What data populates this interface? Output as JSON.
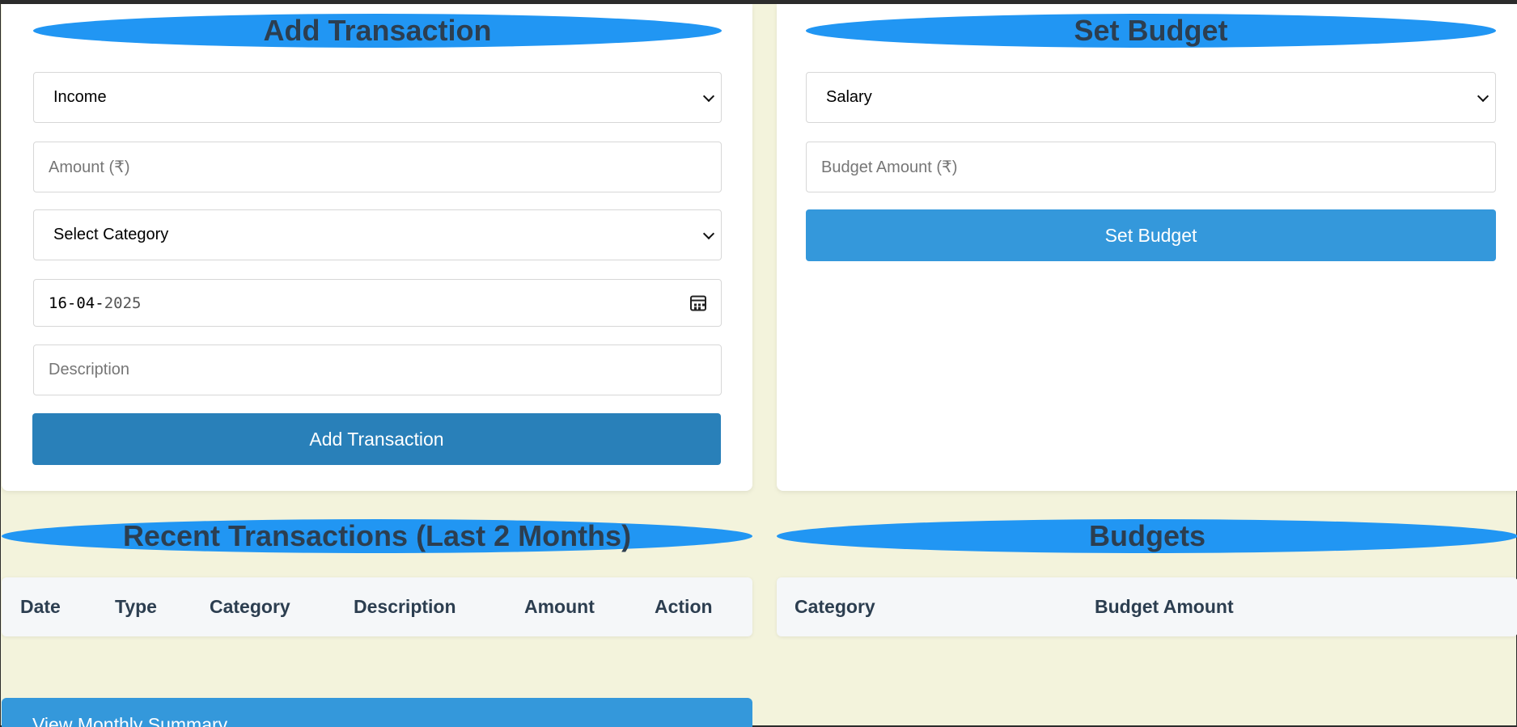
{
  "add_transaction": {
    "title": "Add Transaction",
    "type_value": "Income",
    "amount_placeholder": "Amount (₹)",
    "category_value": "Select Category",
    "date_day": "16",
    "date_month": "04",
    "date_year": "2025",
    "date_sep": "-",
    "description_placeholder": "Description",
    "submit_label": "Add Transaction"
  },
  "set_budget": {
    "title": "Set Budget",
    "category_value": "Salary",
    "amount_placeholder": "Budget Amount (₹)",
    "submit_label": "Set Budget"
  },
  "recent_transactions": {
    "title": "Recent Transactions (Last 2 Months)",
    "columns": [
      "Date",
      "Type",
      "Category",
      "Description",
      "Amount",
      "Action"
    ],
    "rows": []
  },
  "budgets": {
    "title": "Budgets",
    "columns": [
      "Category",
      "Budget Amount"
    ],
    "rows": []
  },
  "summary_button_label": "View Monthly Summary",
  "colors": {
    "background": "#f3f3dc",
    "heading_pill": "#2196f3",
    "heading_text": "#2c3e50",
    "primary_button": "#3498db",
    "primary_button_active": "#2980b9"
  },
  "icons": {
    "select_arrow": "chevron-down-icon",
    "date_picker": "calendar-icon"
  }
}
